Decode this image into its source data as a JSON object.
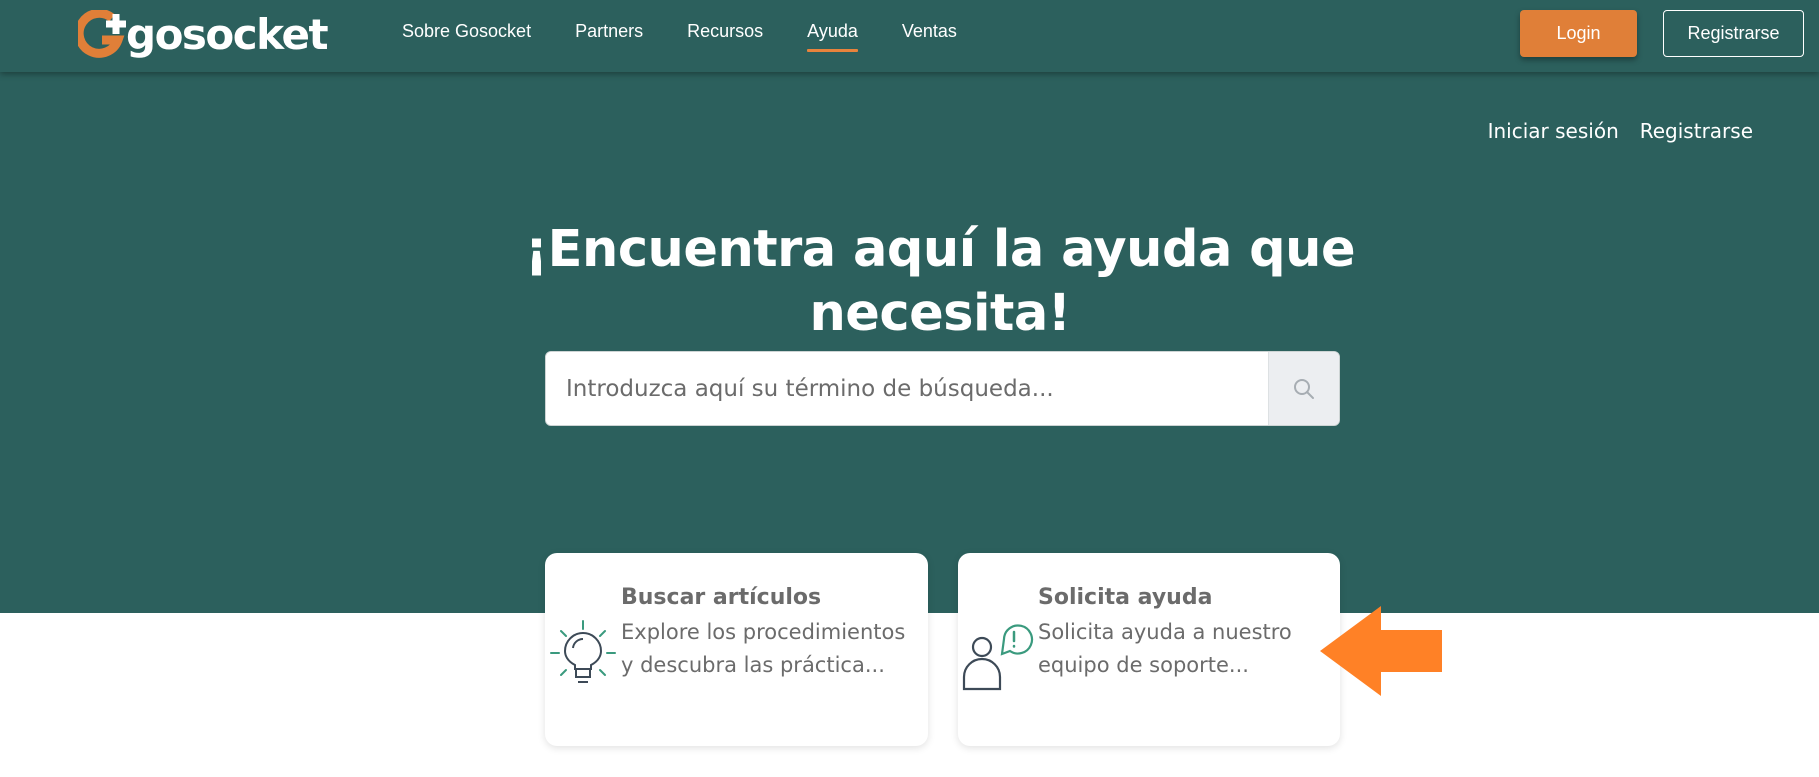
{
  "logo": {
    "text": "gosocket",
    "icon": "gosocket-g-plus-logo"
  },
  "nav": {
    "items": [
      {
        "label": "Sobre Gosocket"
      },
      {
        "label": "Partners"
      },
      {
        "label": "Recursos"
      },
      {
        "label": "Ayuda",
        "active": true
      },
      {
        "label": "Ventas"
      }
    ],
    "login_label": "Login",
    "register_label": "Registrarse"
  },
  "user_links": {
    "sign_in": "Iniciar sesión",
    "register": "Registrarse"
  },
  "hero": {
    "title_line1": "¡Encuentra aquí la ayuda que",
    "title_line2": "necesita!"
  },
  "search": {
    "placeholder": "Introduzca aquí su término de búsqueda...",
    "icon": "search-icon"
  },
  "cards": [
    {
      "title": "Buscar artículos",
      "description": "Explore los procedimientos y descubra las práctica...",
      "icon": "lightbulb-icon"
    },
    {
      "title": "Solicita ayuda",
      "description": "Solicita ayuda a nuestro equipo de soporte...",
      "icon": "person-alert-icon"
    }
  ],
  "colors": {
    "brand_teal": "#2c605d",
    "accent_orange": "#e07f38",
    "annotation_arrow": "#ff8126",
    "icon_green": "#3a9a7e",
    "icon_dark": "#3d4a57"
  }
}
